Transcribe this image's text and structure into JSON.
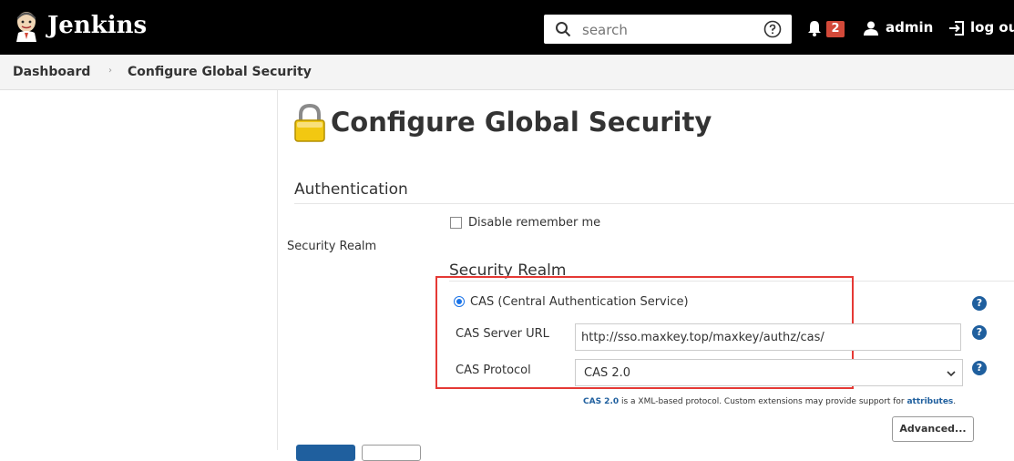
{
  "header": {
    "brand": "Jenkins",
    "search_placeholder": "search",
    "notification_count": "2",
    "username": "admin",
    "logout_label": "log out"
  },
  "breadcrumb": {
    "items": [
      "Dashboard",
      "Configure Global Security"
    ],
    "separator": "›"
  },
  "page": {
    "title": "Configure Global Security"
  },
  "authentication": {
    "heading": "Authentication",
    "disable_remember_me_label": "Disable remember me",
    "security_realm_side_label": "Security Realm",
    "security_realm_heading": "Security Realm",
    "realm_option_label": "CAS (Central Authentication Service)",
    "cas_server_url_label": "CAS Server URL",
    "cas_server_url_value": "http://sso.maxkey.top/maxkey/authz/cas/",
    "cas_protocol_label": "CAS Protocol",
    "cas_protocol_value": "CAS 2.0",
    "help_prefix": "CAS 2.0",
    "help_middle": " is a XML-based protocol. Custom extensions may provide support for ",
    "help_link": "attributes",
    "help_suffix": ".",
    "advanced_label": "Advanced..."
  },
  "help_icon_glyph": "?",
  "colors": {
    "header_bg": "#000000",
    "badge_bg": "#d24939",
    "accent_blue": "#1f5f9e",
    "highlight_red": "#e53935"
  }
}
